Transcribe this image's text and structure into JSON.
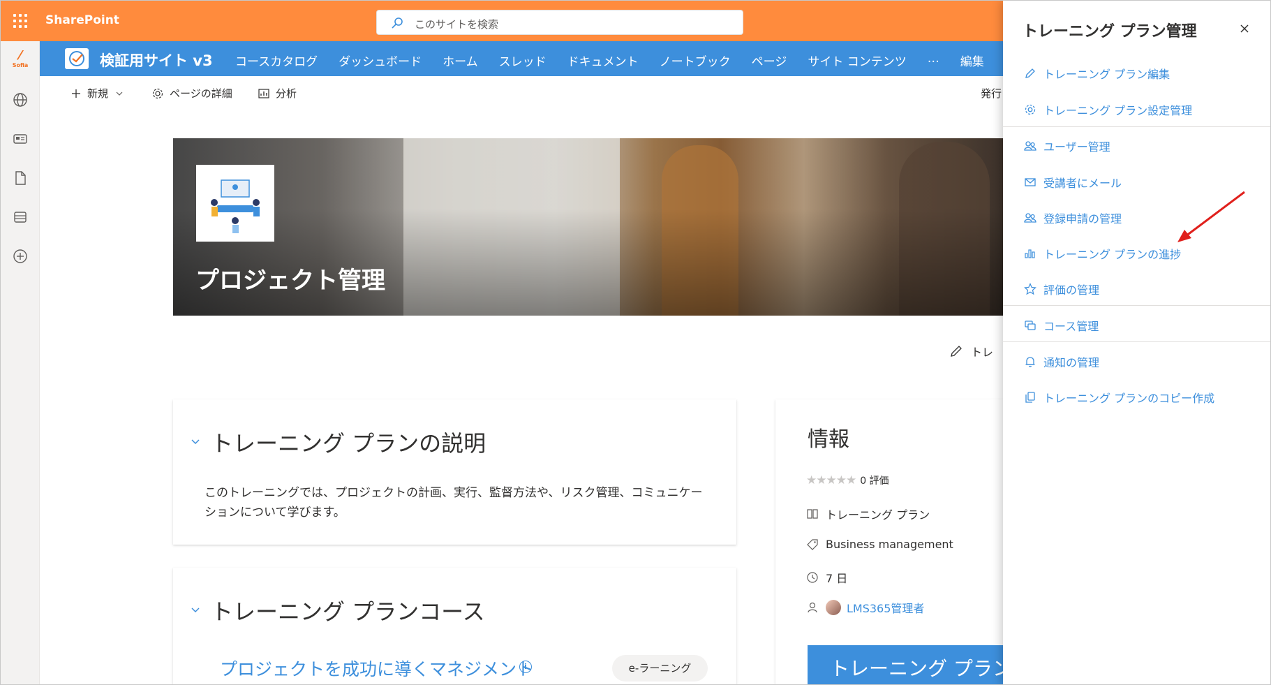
{
  "suitebar": {
    "brand": "SharePoint",
    "search_placeholder": "このサイトを検索",
    "bg_color": "#ff8b3d"
  },
  "appbar": {
    "logo_text": "Sofia",
    "icons": [
      "globe-icon",
      "news-icon",
      "document-icon",
      "list-icon",
      "add-circle-icon"
    ]
  },
  "site": {
    "title": "検証用サイト v3",
    "header_color": "#3d8fdc",
    "nav": [
      "コースカタログ",
      "ダッシュボード",
      "ホーム",
      "スレッド",
      "ドキュメント",
      "ノートブック",
      "ページ",
      "サイト コンテンツ",
      "…",
      "編集"
    ]
  },
  "commandbar": {
    "new_label": "新規",
    "page_details_label": "ページの詳細",
    "analytics_label": "分析",
    "publish_truncated": "発行"
  },
  "hero": {
    "title": "プロジェクト管理"
  },
  "edit_truncated": "トレ",
  "description": {
    "heading": "トレーニング プランの説明",
    "text": "このトレーニングでは、プロジェクトの計画、実行、監督方法や、リスク管理、コミュニケーションについて学びます。"
  },
  "courses": {
    "heading": "トレーニング プランコース",
    "course_title": "プロジェクトを成功に導くマネジメント",
    "info_mark": "i",
    "course_type": "e-ラーニング"
  },
  "info": {
    "title": "情報",
    "stars": "★★★★★",
    "rating_text": "0 評価",
    "type": "トレーニング プラン",
    "category": "Business management",
    "duration": "7 日",
    "owner": "LMS365管理者",
    "button_label": "トレーニング プラン"
  },
  "panel": {
    "title": "トレーニング プラン管理",
    "items": [
      {
        "label": "トレーニング プラン編集",
        "icon": "pencil-icon"
      },
      {
        "label": "トレーニング プラン設定管理",
        "icon": "gear-icon"
      },
      {
        "label": "ユーザー管理",
        "icon": "people-icon"
      },
      {
        "label": "受講者にメール",
        "icon": "mail-icon"
      },
      {
        "label": "登録申請の管理",
        "icon": "people-icon"
      },
      {
        "label": "トレーニング プランの進捗",
        "icon": "bar-chart-icon"
      },
      {
        "label": "評価の管理",
        "icon": "star-icon"
      },
      {
        "label": "コース管理",
        "icon": "courses-icon"
      },
      {
        "label": "通知の管理",
        "icon": "bell-icon"
      },
      {
        "label": "トレーニング プランのコピー作成",
        "icon": "copy-icon"
      }
    ],
    "accent_color": "#3d8fdc"
  },
  "annotation": {
    "arrow_color": "#e0201c"
  }
}
